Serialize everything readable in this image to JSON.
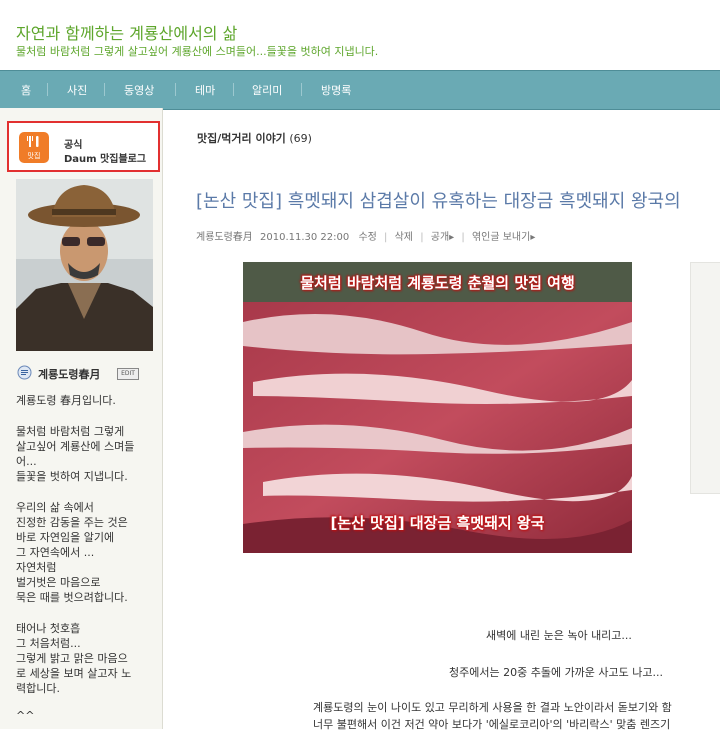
{
  "header": {
    "title": "자연과 함께하는 계룡산에서의 삶",
    "subtitle": "물처럼 바람처럼 그렇게 살고싶어 계룡산에 스며들어...들꽃을 벗하여 지냅니다."
  },
  "nav": {
    "items": [
      "홈",
      "사진",
      "동영상",
      "테마",
      "알리미",
      "방명록"
    ]
  },
  "sidebar": {
    "official_label": "공식",
    "official_blog": "Daum 맛집블로그",
    "food_icon_label": "맛집",
    "profile_name": "계룡도령春月",
    "edit_badge": "EDIT",
    "intro": [
      "계룡도령 春月입니다.",
      "물처럼 바람처럼 그렇게",
      "살고싶어 계룡산에 스며들",
      "어...",
      "들꽃을 벗하여 지냅니다.",
      "우리의 삶 속에서",
      "진정한 감동을 주는 것은",
      "바로 자연임을 알기에",
      "그 자연속에서 ...",
      "자연처럼",
      "벌거벗은 마음으로",
      "묵은 때를 벗으려합니다.",
      "태어나 첫호흡",
      "그 처음처럼...",
      "그렇게 밝고 맑은 마음으",
      "로 세상을 보며 살고자 노",
      "력합니다.",
      "^^"
    ]
  },
  "main": {
    "category": "맛집/먹거리 이야기",
    "category_count": "(69)",
    "post_title": "[논산 맛집] 흑멧돼지 삼겹살이 유혹하는 대장금 흑멧돼지 왕국의",
    "meta": {
      "author": "계룡도령春月",
      "date": "2010.11.30 22:00",
      "edit": "수정",
      "delete": "삭제",
      "visibility": "공개",
      "trackback": "엮인글 보내기"
    },
    "image_caption_top": "물처럼 바람처럼 계룡도령 춘월의 맛집 여행",
    "image_caption_bottom": "[논산 맛집] 대장금 흑멧돼지 왕국",
    "body": [
      "새벽에 내린 눈은 녹아 내리고...",
      "청주에서는 20중 추돌에 가까운 사고도 나고...",
      "계룡도령의 눈이 나이도 있고 무리하게 사용을 한 결과 노안이라서 돋보기와 함",
      "너무 불편해서 이건 저건 약아 보다가 '에실로코리아'의 '바리락스' 맞춤 렌즈기"
    ]
  },
  "colors": {
    "header_green": "#5ea62c",
    "nav_bg": "#6aaab4",
    "title_blue": "#5b7aa8",
    "highlight_red": "#e23030",
    "food_orange": "#f07c28"
  }
}
